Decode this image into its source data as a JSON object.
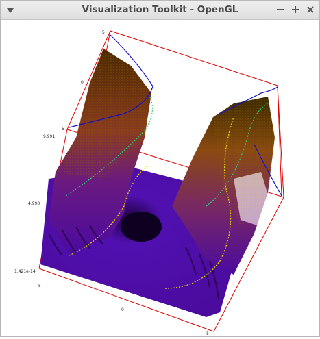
{
  "window": {
    "title": "Visualization Toolkit - OpenGL",
    "menu_icon": "triangle-down-icon",
    "minimize_icon": "minus-icon",
    "maximize_icon": "plus-icon",
    "close_icon": "close-icon"
  },
  "plot": {
    "axis_labels": {
      "z_top": "9.991",
      "z_mid": "4.990",
      "z_bottom": "1.421e-14",
      "back_top": "5",
      "back_zero": "0",
      "back_bottom": "-5",
      "front_left": "5",
      "front_zero": "0",
      "front_right": "-5"
    },
    "colors": {
      "bounding_box": "#e00000",
      "surface_base": "#4b0aa0",
      "surface_peak": "#8a4a10",
      "contour_yellow": "#e8e000",
      "contour_green": "#30d080",
      "contour_blue": "#1010cc"
    }
  }
}
